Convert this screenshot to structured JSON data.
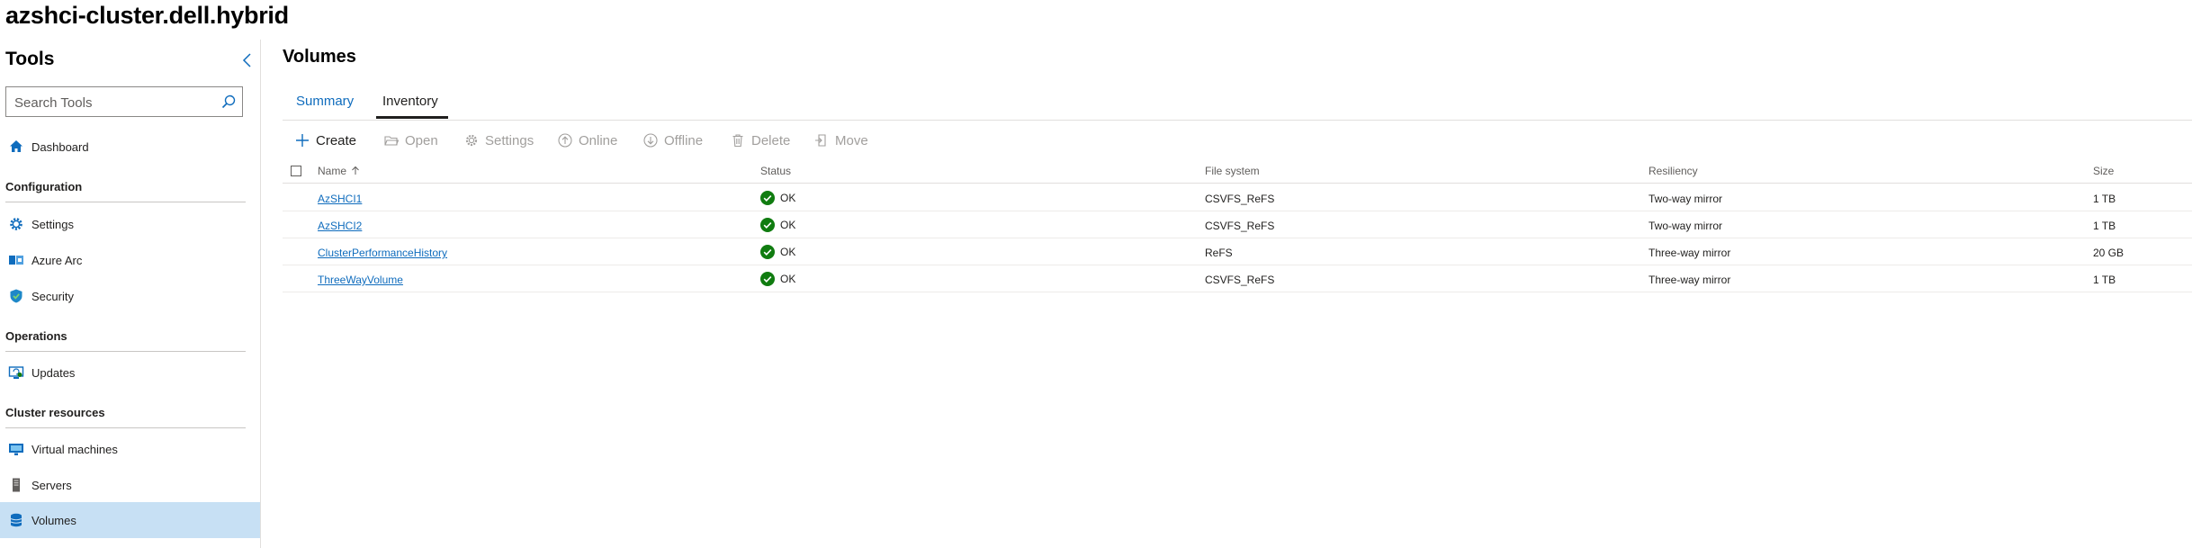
{
  "cluster_name": "azshci-cluster.dell.hybrid",
  "sidebar": {
    "title": "Tools",
    "search_placeholder": "Search Tools",
    "items": [
      {
        "label": "Dashboard",
        "icon": "home-icon"
      },
      {
        "label": "Settings",
        "icon": "gear-icon"
      },
      {
        "label": "Azure Arc",
        "icon": "azure-arc-icon"
      },
      {
        "label": "Security",
        "icon": "shield-icon"
      },
      {
        "label": "Updates",
        "icon": "updates-icon"
      },
      {
        "label": "Virtual machines",
        "icon": "monitor-icon"
      },
      {
        "label": "Servers",
        "icon": "server-icon"
      },
      {
        "label": "Volumes",
        "icon": "volumes-icon",
        "selected": true
      }
    ],
    "sections": {
      "configuration": "Configuration",
      "operations": "Operations",
      "cluster_resources": "Cluster resources"
    }
  },
  "main": {
    "title": "Volumes",
    "tabs": [
      {
        "label": "Summary",
        "active": false
      },
      {
        "label": "Inventory",
        "active": true
      }
    ],
    "toolbar": {
      "create": "Create",
      "open": "Open",
      "settings": "Settings",
      "online": "Online",
      "offline": "Offline",
      "delete": "Delete",
      "move": "Move"
    },
    "table": {
      "headers": {
        "name": "Name",
        "status": "Status",
        "filesystem": "File system",
        "resiliency": "Resiliency",
        "size": "Size"
      },
      "rows": [
        {
          "name": "AzSHCI1",
          "status": "OK",
          "filesystem": "CSVFS_ReFS",
          "resiliency": "Two-way mirror",
          "size": "1 TB"
        },
        {
          "name": "AzSHCI2",
          "status": "OK",
          "filesystem": "CSVFS_ReFS",
          "resiliency": "Two-way mirror",
          "size": "1 TB"
        },
        {
          "name": "ClusterPerformanceHistory",
          "status": "OK",
          "filesystem": "ReFS",
          "resiliency": "Three-way mirror",
          "size": "20 GB"
        },
        {
          "name": "ThreeWayVolume",
          "status": "OK",
          "filesystem": "CSVFS_ReFS",
          "resiliency": "Three-way mirror",
          "size": "1 TB"
        }
      ]
    }
  },
  "colors": {
    "accent": "#0f6cbd",
    "selected_bg": "#c7e0f4",
    "ok_green": "#107c10",
    "disabled_text": "#a19f9d"
  }
}
